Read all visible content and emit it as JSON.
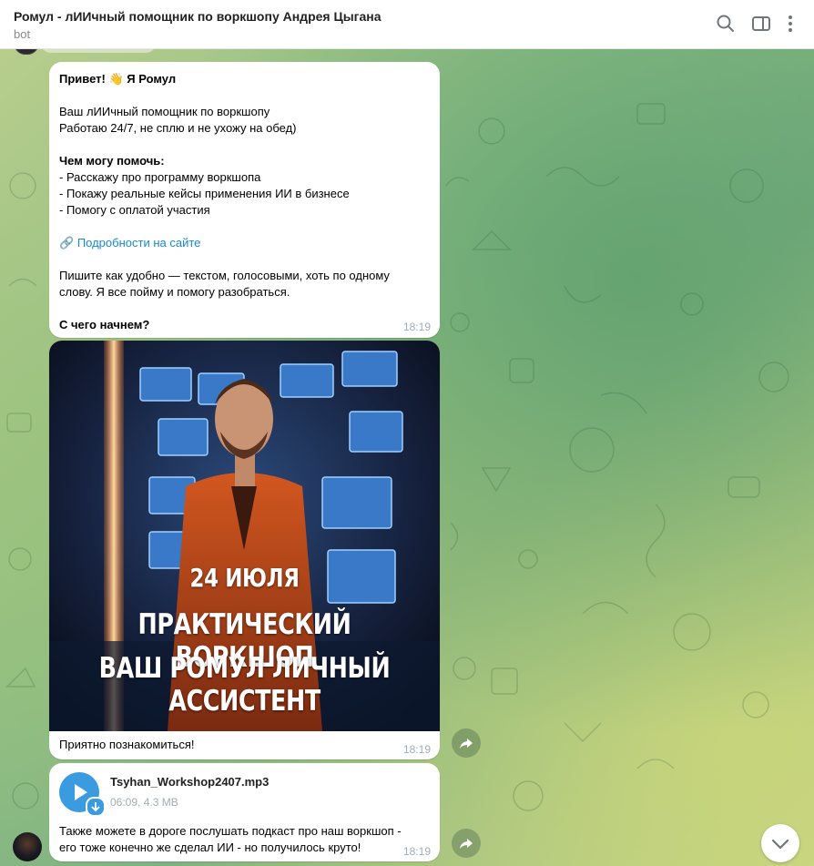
{
  "header": {
    "title": "Ромул - лИИчный помощник по воркшопу Андрея Цыгана",
    "status": "bot"
  },
  "icons": [
    "search-icon",
    "sidebar-toggle-icon",
    "more-vertical-icon"
  ],
  "messages": {
    "m1": {
      "greeting": "Привет! 👋 Я Ромул",
      "intro1": "Ваш лИИчный помощник по воркшопу",
      "intro2": "Работаю 24/7, не сплю и не ухожу на обед)",
      "help_title": "Чем могу помочь:",
      "help1": "- Расскажу про программу воркшопа",
      "help2": "- Покажу реальные кейсы применения ИИ в бизнесе",
      "help3": "- Помогу с оплатой участия",
      "link_emoji": "🔗",
      "link": "Подробности на сайте",
      "write1": "Пишите как удобно — текстом, голосовыми, хоть по одному",
      "write2": "слову. Я все пойму и помогу разобраться.",
      "question": "С чего начнем?",
      "time": "18:19"
    },
    "m2": {
      "poster_line1": "24 ИЮЛЯ",
      "poster_line2": "ПРАКТИЧЕСКИЙ ВОРКШОП",
      "poster_line3": "ВАШ РОМУЛ ЛИЧНЫЙ АССИСТЕНТ",
      "caption": "Приятно познакомиться!",
      "time": "18:19"
    },
    "m3": {
      "file_name": "Tsyhan_Workshop2407.mp3",
      "file_meta": "06:09, 4.3 MB",
      "text1": "Также можете в дороге послушать подкаст про наш воркшоп -",
      "text2": "его тоже конечно же сделал ИИ - но получилось круто!",
      "time": "18:19"
    }
  },
  "colors": {
    "accent": "#168acd",
    "play_button": "#3a9be0",
    "time": "#a0acb6"
  }
}
